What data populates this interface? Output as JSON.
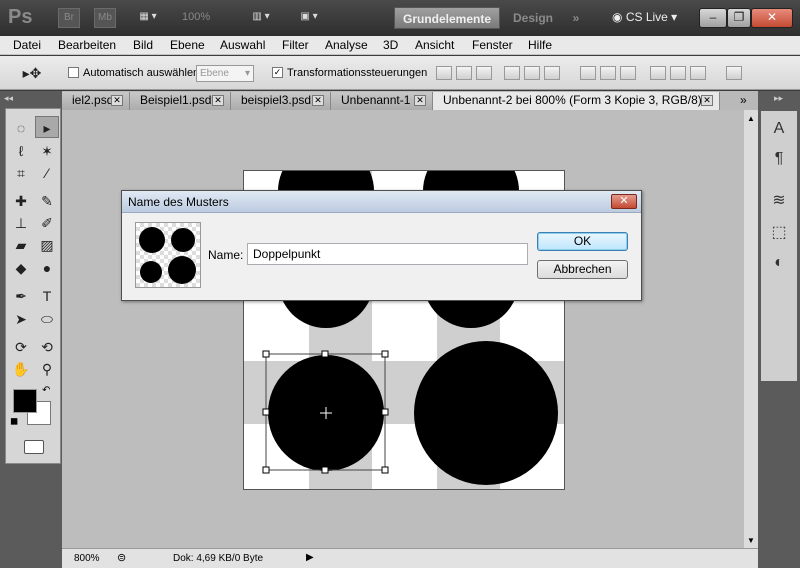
{
  "app": {
    "logo": "Ps",
    "mini_bridge": "Br",
    "mini_mb": "Mb",
    "zoom_display": "100%"
  },
  "workspace": {
    "active": "Grundelemente",
    "other": "Design",
    "more": "»",
    "cslive": "CS Live"
  },
  "window_buttons": {
    "minimize": "–",
    "restore": "❐",
    "close": "✕"
  },
  "menu": [
    "Datei",
    "Bearbeiten",
    "Bild",
    "Ebene",
    "Auswahl",
    "Filter",
    "Analyse",
    "3D",
    "Ansicht",
    "Fenster",
    "Hilfe"
  ],
  "options": {
    "auto_select_label": "Automatisch auswählen:",
    "auto_select_value": "Ebene",
    "transform_label": "Transformationssteuerungen",
    "transform_checked": "✓"
  },
  "tabs": [
    {
      "label": "iel2.psd"
    },
    {
      "label": "Beispiel1.psd"
    },
    {
      "label": "beispiel3.psd"
    },
    {
      "label": "Unbenannt-1"
    },
    {
      "label": "Unbenannt-2 bei 800% (Form 3 Kopie 3, RGB/8) *"
    }
  ],
  "tab_overflow": "»",
  "status": {
    "zoom": "800%",
    "doc_info": "Dok: 4,69 KB/0 Byte"
  },
  "dialog": {
    "title": "Name des Musters",
    "name_label": "Name:",
    "name_value": "Doppelpunkt",
    "ok": "OK",
    "cancel": "Abbrechen"
  },
  "icons": [
    "marquee-icon",
    "move-icon",
    "lasso-icon",
    "magic-wand-icon",
    "crop-icon",
    "eyedropper-icon",
    "healing-icon",
    "brush-icon",
    "stamp-icon",
    "history-brush-icon",
    "eraser-icon",
    "gradient-icon",
    "blur-icon",
    "dodge-icon",
    "pen-icon",
    "type-icon",
    "path-select-icon",
    "shape-icon",
    "3d-rotate-icon",
    "3d-orbit-icon",
    "hand-icon",
    "zoom-icon",
    "character-icon",
    "paragraph-icon",
    "layers-icon",
    "paths-icon",
    "adjust-icon"
  ],
  "colors": {
    "foreground": "#000000",
    "background": "#ffffff"
  }
}
